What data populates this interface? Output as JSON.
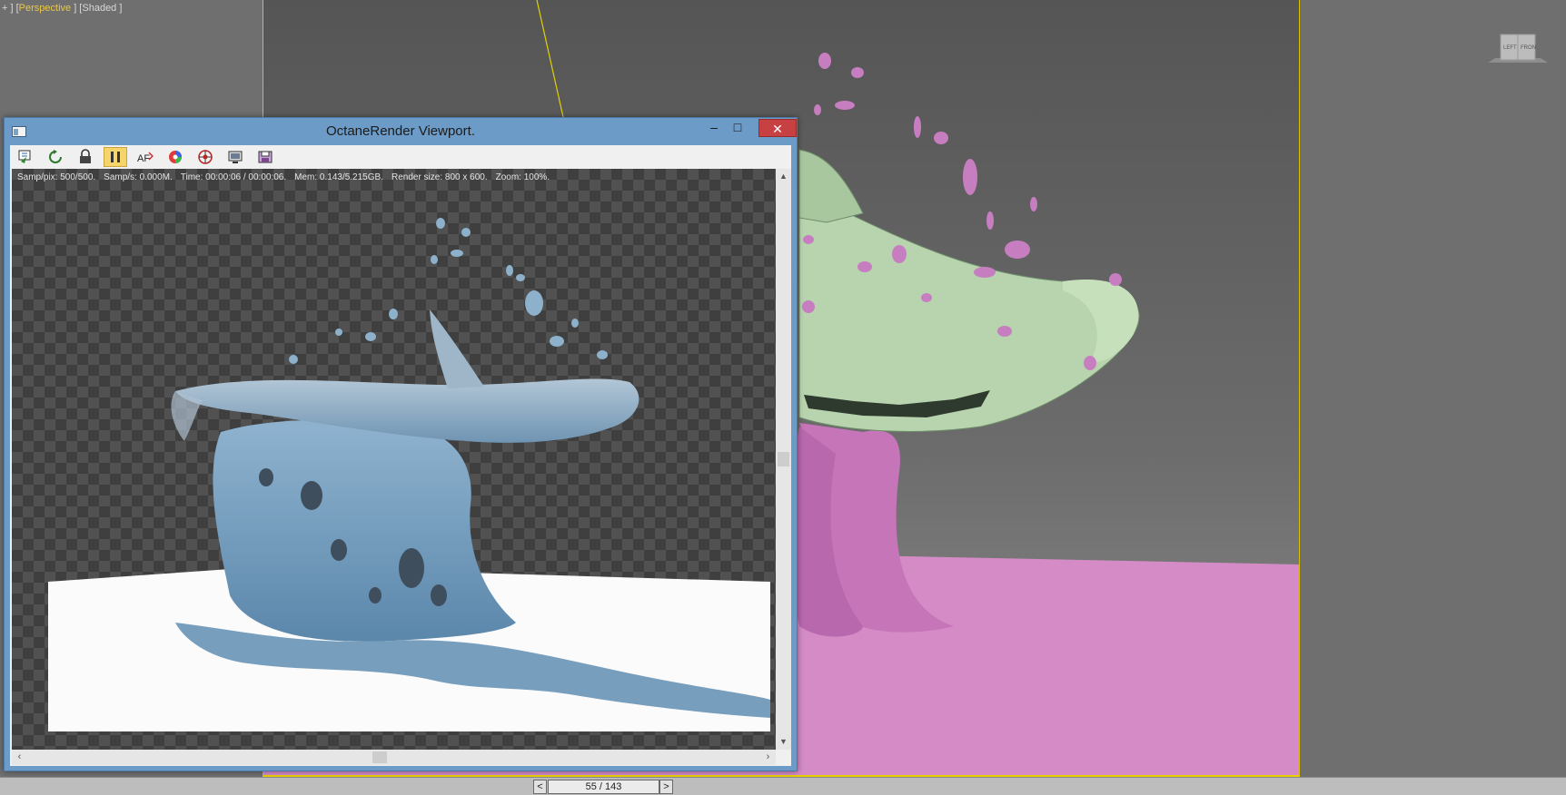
{
  "viewport": {
    "label_prefix": "+ ] [",
    "view_name": "Perspective",
    "label_mid": " ] [",
    "shading": "Shaded",
    "label_suffix": " ]",
    "viewcube_left": "LEFT",
    "viewcube_front": "FRON"
  },
  "octane": {
    "title": "OctaneRender Viewport.",
    "toolbar_icons": [
      "send-scene-icon",
      "refresh-icon",
      "lock-icon",
      "pause-icon",
      "af-focus-icon",
      "color-picker-icon",
      "region-icon",
      "display-icon",
      "save-image-icon"
    ],
    "active_tool": "pause-icon",
    "status": {
      "samp_pix": "Samp/pix: 500/500.",
      "samp_s": "Samp/s: 0.000M.",
      "time": "Time: 00:00:06 / 00:00:06.",
      "mem": "Mem: 0.143/5.215GB.",
      "render_size": "Render size: 800 x 600.",
      "zoom": "Zoom: 100%."
    }
  },
  "timeline": {
    "prev": "<",
    "frame": "55 / 143",
    "next": ">"
  },
  "colors": {
    "viewport_border": "#e8d000",
    "titlebar": "#6b9bc6",
    "close": "#c74142",
    "shark_preview": "#b9d6b0",
    "fluid_preview": "#d690c8",
    "fluid_render": "#6e96b6"
  }
}
